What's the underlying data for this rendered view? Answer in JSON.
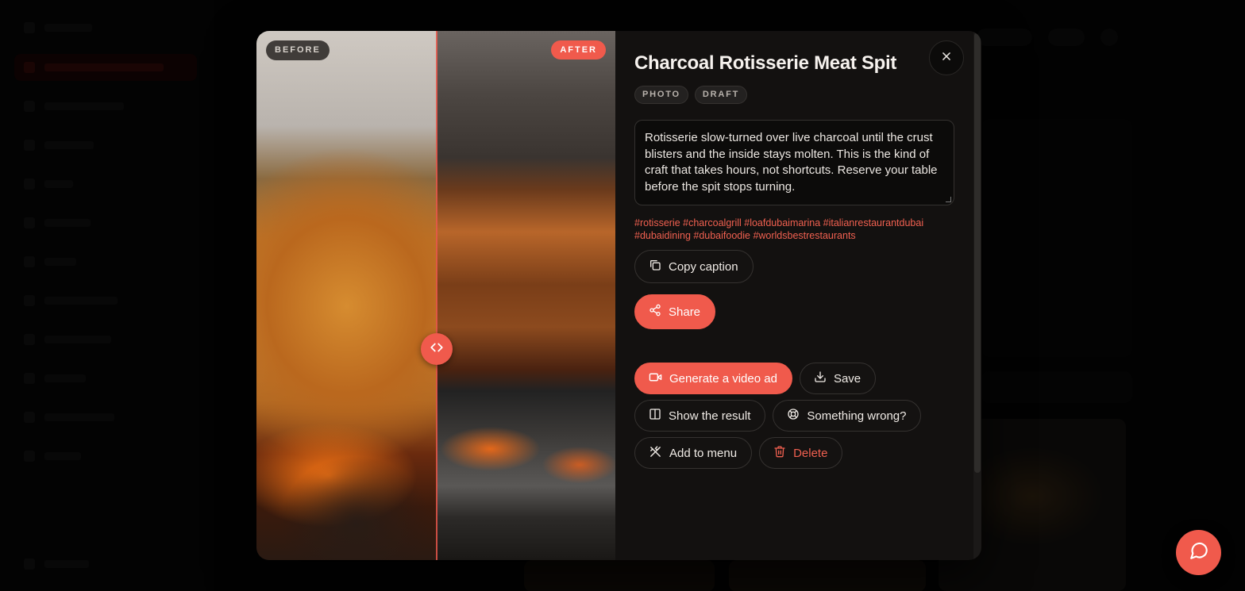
{
  "modal": {
    "title": "Charcoal Rotisserie Meat Spit",
    "tags": [
      "PHOTO",
      "DRAFT"
    ],
    "caption": "Rotisserie slow-turned over live charcoal until the crust blisters and the inside stays molten. This is the kind of craft that takes hours, not shortcuts. Reserve your table before the spit stops turning.",
    "hashtags": "#rotisserie #charcoalgrill #loafdubaimarina #italianrestaurantdubai #dubaidining #dubaifoodie #worldsbestrestaurants",
    "compare": {
      "before_label": "BEFORE",
      "after_label": "AFTER",
      "handle_icon": "code-arrows-icon",
      "slider_position": 0.5
    },
    "buttons": {
      "copy_caption": "Copy caption",
      "share": "Share",
      "generate_video_ad": "Generate a video ad",
      "save": "Save",
      "show_result": "Show the result",
      "something_wrong": "Something wrong?",
      "add_to_menu": "Add to menu",
      "delete": "Delete"
    },
    "close_icon": "close-icon"
  },
  "colors": {
    "accent": "#f05a4c",
    "modal_bg": "#131110",
    "page_bg": "#050505"
  },
  "chat_fab_icon": "chat-bubble-icon"
}
